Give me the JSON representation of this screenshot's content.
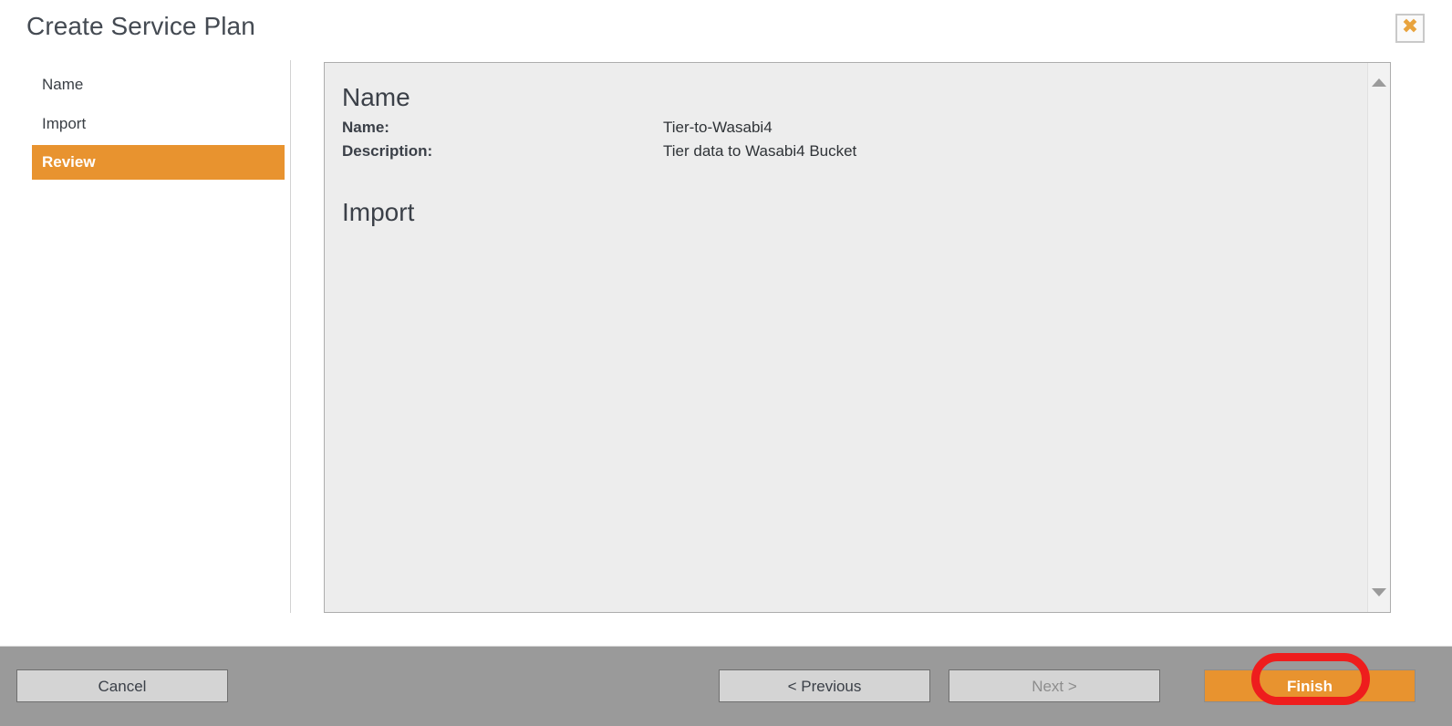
{
  "dialog": {
    "title": "Create Service Plan",
    "close_label": "✖",
    "close_icon": "close-x-icon"
  },
  "steps": [
    {
      "label": "Name",
      "active": false
    },
    {
      "label": "Import",
      "active": false
    },
    {
      "label": "Review",
      "active": true
    }
  ],
  "review": {
    "sections": [
      {
        "heading": "Name",
        "fields": [
          {
            "label": "Name:",
            "value": "Tier-to-Wasabi4"
          },
          {
            "label": "Description:",
            "value": "Tier data to Wasabi4 Bucket"
          }
        ]
      },
      {
        "heading": "Import",
        "fields": []
      }
    ],
    "scrollbar": {
      "up_icon": "scroll-up-arrow-icon",
      "down_icon": "scroll-down-arrow-icon"
    }
  },
  "footer": {
    "cancel_label": "Cancel",
    "previous_label": "< Previous",
    "next_label": "Next >",
    "next_disabled": true,
    "finish_label": "Finish"
  },
  "annotation": {
    "target": "finish-button",
    "color": "#ee1d1d"
  },
  "colors": {
    "accent_orange": "#e8932f",
    "footer_gray": "#9a9a9a",
    "panel_gray": "#ededed",
    "title_text": "#444a52",
    "annotation_red": "#ee1d1d"
  }
}
